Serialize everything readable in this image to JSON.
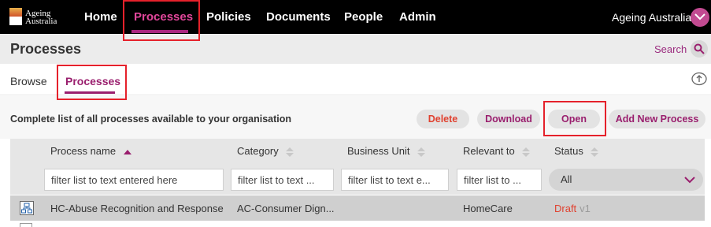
{
  "nav": {
    "logo_line1": "Ageing",
    "logo_line2": "Australia",
    "items": [
      "Home",
      "Processes",
      "Policies",
      "Documents",
      "People",
      "Admin"
    ],
    "active_item": "Processes",
    "user_name": "Ageing Australia"
  },
  "header": {
    "title": "Processes",
    "search_label": "Search"
  },
  "tabs": {
    "items": [
      "Browse",
      "Processes"
    ],
    "active": "Processes"
  },
  "toolbar": {
    "description": "Complete list of all processes available to your organisation",
    "buttons": {
      "delete": "Delete",
      "download": "Download",
      "open": "Open",
      "add_new": "Add New Process"
    }
  },
  "table": {
    "columns": [
      "Process name",
      "Category",
      "Business Unit",
      "Relevant to",
      "Status"
    ],
    "sorted_column": "Process name",
    "filters": {
      "process_name_placeholder": "filter list to text entered here",
      "category_placeholder": "filter list to text ...",
      "business_unit_placeholder": "filter list to text e...",
      "relevant_to_placeholder": "filter list to ...",
      "status_value": "All"
    },
    "rows": [
      {
        "process_name": "HC-Abuse Recognition and Response",
        "category": "AC-Consumer Dign...",
        "business_unit": "",
        "relevant_to": "HomeCare",
        "status": "Draft",
        "version": "v1"
      }
    ]
  },
  "colors": {
    "nav_bg": "#000000",
    "accent": "#9a1f6e",
    "active_nav": "#e2479b",
    "danger": "#e0412f",
    "highlight_box": "#e5212b"
  }
}
